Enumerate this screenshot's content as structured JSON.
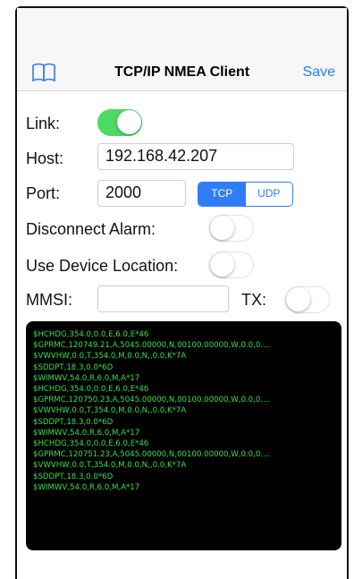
{
  "nav": {
    "title": "TCP/IP NMEA Client",
    "save_label": "Save",
    "left_icon": "book-icon"
  },
  "link": {
    "label": "Link:",
    "on": true
  },
  "host": {
    "label": "Host:",
    "value": "192.168.42.207"
  },
  "port": {
    "label": "Port:",
    "value": "2000",
    "protocols": [
      "TCP",
      "UDP"
    ],
    "selected": "TCP"
  },
  "disconnect_alarm": {
    "label": "Disconnect Alarm:",
    "on": false
  },
  "use_device_location": {
    "label": "Use Device Location:",
    "on": false
  },
  "mmsi": {
    "label": "MMSI:",
    "value": ""
  },
  "tx": {
    "label": "TX:",
    "on": false
  },
  "console": {
    "lines": [
      "$HCHDG,354.0,0.0,E,6.0,E*46",
      "$GPRMC,120749.21,A,5045.00000,N,00100.00000,W,0.0,0....",
      "$VWVHW,0.0,T,354.0,M,0.0,N,,0.0,K*7A",
      "$SDDPT,18.3,0.0*6D",
      "$WIMWV,54.0,R,6.0,M,A*17",
      "$HCHDG,354.0,0.0,E,6.0,E*46",
      "$GPRMC,120750.23,A,5045.00000,N,00100.00000,W,0.0,0....",
      "$VWVHW,0.0,T,354.0,M,0.0,N,,0.0,K*7A",
      "$SDDPT,18.3,0.0*6D",
      "$WIMWV,54.0,R,6.0,M,A*17",
      "$HCHDG,354.0,0.0,E,6.0,E*46",
      "$GPRMC,120751.23,A,5045.00000,N,00100.00000,W,0.0,0....",
      "$VWVHW,0.0,T,354.0,M,0.0,N,,0.0,K*7A",
      "$SDDPT,18.3,0.0*6D",
      "$WIMWV,54.0,R,6.0,M,A*17"
    ]
  },
  "colors": {
    "accent": "#2f7df6",
    "toggle_on": "#4cd964",
    "console_text": "#33e04a"
  }
}
